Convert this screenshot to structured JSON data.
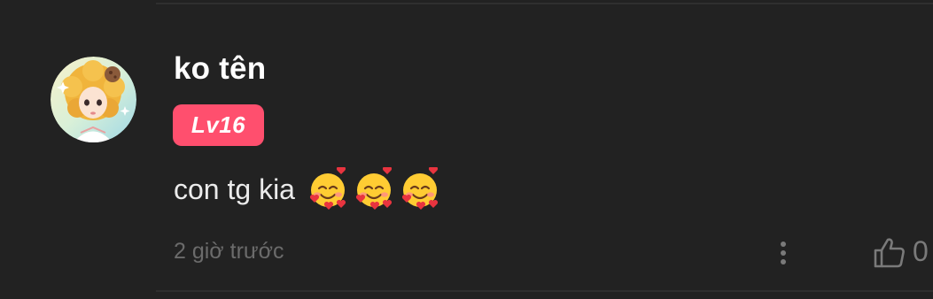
{
  "comment": {
    "username": "ko tên",
    "level_badge": "Lv16",
    "text": "con tg kia",
    "emojis": [
      "smiling-face-with-hearts",
      "smiling-face-with-hearts",
      "smiling-face-with-hearts"
    ],
    "timestamp": "2 giờ trước",
    "like_count": "0"
  },
  "colors": {
    "background": "#222222",
    "badge": "#ff4f6e",
    "username": "#ffffff",
    "text": "#ebebeb",
    "muted": "#6b6b6b"
  },
  "icons": {
    "more": "more-vertical-icon",
    "like": "thumbs-up-icon"
  }
}
